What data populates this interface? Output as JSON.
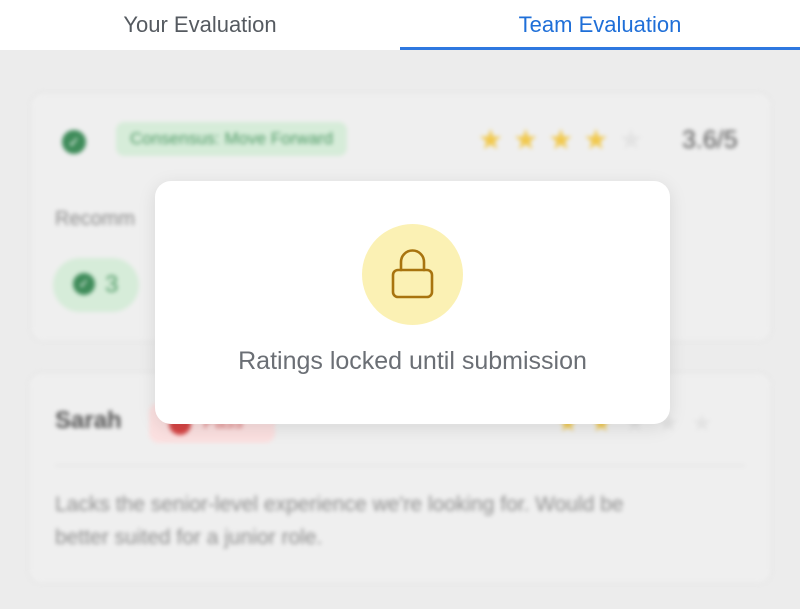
{
  "tabs": [
    {
      "label": "Your Evaluation",
      "active": false
    },
    {
      "label": "Team Evaluation",
      "active": true
    }
  ],
  "summary": {
    "consensus_label": "Consensus: Move Forward",
    "rating": {
      "filled": 4,
      "total": 5
    },
    "score_text": "3.6/5",
    "recommend_label": "Recomm",
    "recommend_count": "3"
  },
  "review": {
    "reviewer_name": "Sarah",
    "verdict": "Pass",
    "rating": {
      "filled": 2,
      "total": 5
    },
    "comment_line1": "Lacks the senior-level experience we're looking for. Would be",
    "comment_line2": "better suited for a junior role."
  },
  "modal": {
    "icon": "lock-icon",
    "message": "Ratings locked until submission"
  },
  "colors": {
    "accent": "#1f6fd8",
    "success": "#3f8c5a",
    "star": "#f1c94f",
    "lock_bg": "#fbf1b4",
    "lock_stroke": "#a8740f"
  }
}
